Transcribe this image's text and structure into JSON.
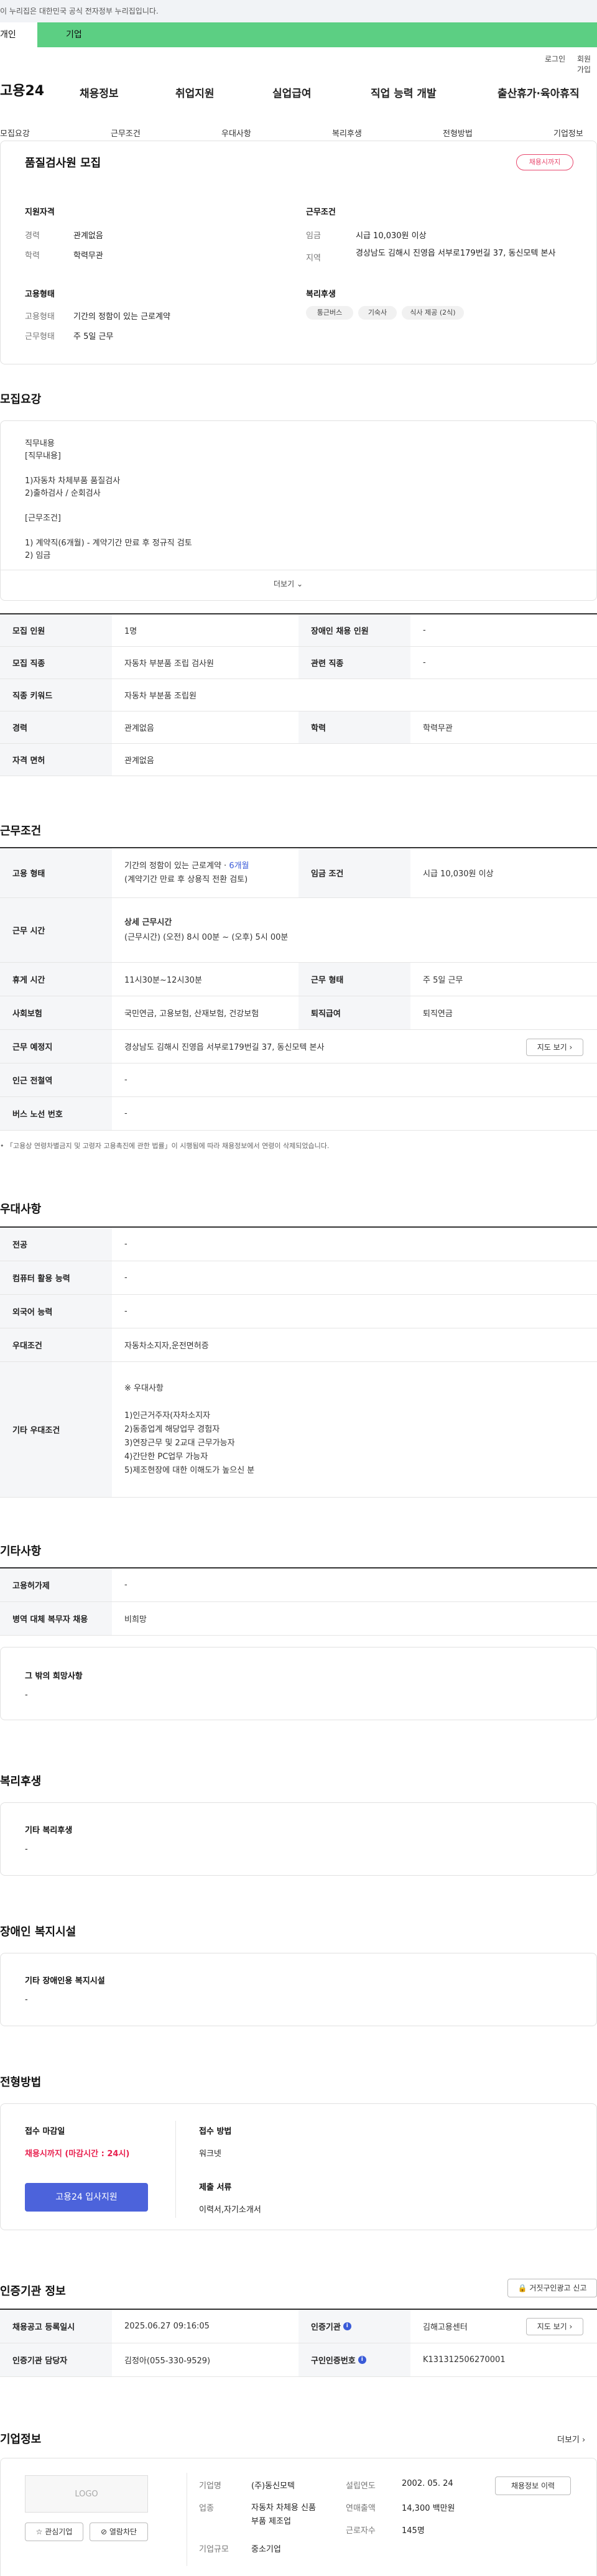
{
  "gov_banner": "이 누리집은 대한민국 공식 전자정부 누리집입니다.",
  "top_tabs": {
    "personal": "개인",
    "company": "기업"
  },
  "util": {
    "login": "로그인",
    "join": "회원가입"
  },
  "logo": "고용24",
  "gnb": [
    "채용정보",
    "취업지원",
    "실업급여",
    "직업 능력 개발",
    "출산휴가·육아휴직"
  ],
  "subnav": [
    "모집요강",
    "근무조건",
    "우대사항",
    "복리후생",
    "전형방법",
    "기업정보"
  ],
  "summary": {
    "title": "품질검사원 모집",
    "status_badge": "채용시까지",
    "qual_head": "지원자격",
    "career_label": "경력",
    "career_value": "관계없음",
    "edu_label": "학력",
    "edu_value": "학력무관",
    "emp_head": "고용형태",
    "emp_type_label": "고용형태",
    "emp_type_value": "기간의 정함이 있는 근로계약",
    "work_type_label": "근무형태",
    "work_type_value": "주 5일 근무",
    "cond_head": "근무조건",
    "wage_label": "임금",
    "wage_value": "시급 10,030원 이상",
    "region_label": "지역",
    "region_value": "경상남도 김해시 진영읍 서부로179번길 37, 동신모텍 본사",
    "welfare_head": "복리후생",
    "welfare_chips": [
      "통근버스",
      "기숙사",
      "식사 제공 (2식)"
    ]
  },
  "recruit": {
    "title": "모집요강",
    "detail_text": "직무내용\n[직무내용]\n\n1)자동차 차체부품 품질검사\n2)출하검사 / 순회검사\n\n[근무조건]\n\n1) 계약직(6개월) - 계약기간 만료 후 정규직 검토\n2) 임금",
    "more": "더보기",
    "rows": [
      {
        "th1": "모집 인원",
        "td1": "1명",
        "th2": "장애인 채용 인원",
        "td2": "-"
      },
      {
        "th1": "모집 직종",
        "td1": "자동차 부분품 조립 검사원",
        "th2": "관련 직종",
        "td2": "-"
      },
      {
        "th1": "직종 키워드",
        "td1": "자동차 부분품 조립원"
      },
      {
        "th1": "경력",
        "td1": "관계없음",
        "th2": "학력",
        "td2": "학력무관"
      },
      {
        "th1": "자격 면허",
        "td1": "관계없음"
      }
    ]
  },
  "conditions": {
    "title": "근무조건",
    "emp_type_label": "고용 형태",
    "emp_type_line1": "기간의 정함이 있는 근로계약 · ",
    "emp_type_months": "6개월",
    "emp_type_line2": "(계약기간 만료 후 상용직 전환 검토)",
    "wage_label": "임금 조건",
    "wage_value": "시급 10,030원 이상",
    "hours_label": "근무 시간",
    "hours_head": "상세 근무시간",
    "hours_value": "(근무시간) (오전) 8시 00분 ~ (오후) 5시 00분",
    "break_label": "휴게 시간",
    "break_value": "11시30분~12시30분",
    "form_label": "근무 형태",
    "form_value": "주 5일 근무",
    "insurance_label": "사회보험",
    "insurance_value": "국민연금, 고용보험, 산재보험, 건강보험",
    "retire_label": "퇴직급여",
    "retire_value": "퇴직연금",
    "place_label": "근무 예정지",
    "place_value": "경상남도 김해시 진영읍 서부로179번길 37, 동신모텍 본사",
    "map_btn": "지도 보기",
    "subway_label": "인근 전철역",
    "subway_value": "-",
    "bus_label": "버스 노선 번호",
    "bus_value": "-",
    "footnote": "「고용상 연령차별금지 및 고령자 고용촉진에 관한 법률」이 시행됨에 따라 채용정보에서 연령이 삭제되었습니다."
  },
  "preference": {
    "title": "우대사항",
    "major_label": "전공",
    "major_value": "-",
    "pc_label": "컴퓨터 활용 능력",
    "pc_value": "-",
    "lang_label": "외국어 능력",
    "lang_value": "-",
    "pref_label": "우대조건",
    "pref_value": "자동차소지자,운전면허증",
    "etc_label": "기타 우대조건",
    "etc_value": "※ 우대사항\n\n1)인근거주자(자차소지자\n2)동종업계 해당업무 경험자\n3)연장근무 및 2교대 근무가능자\n4)간단한 PC업무 가능자\n5)제조현장에 대한 이해도가 높으신 분"
  },
  "etc": {
    "title": "기타사항",
    "employment_label": "고용허가제",
    "employment_value": "-",
    "military_label": "병역 대체 복무자 채용",
    "military_value": "비희망",
    "other_head": "그 밖의 희망사항",
    "other_value": "-"
  },
  "welfare": {
    "title": "복리후생",
    "head": "기타 복리후생",
    "value": "-"
  },
  "disabled": {
    "title": "장애인 복지시설",
    "head": "기타 장애인용 복지시설",
    "value": "-"
  },
  "selection": {
    "title": "전형방법",
    "deadline_head": "접수 마감일",
    "deadline_value": "채용시까지 (마감시간 : 24시)",
    "apply_btn": "고용24 입사지원",
    "method_head": "접수 방법",
    "method_value": "워크넷",
    "docs_head": "제출 서류",
    "docs_value": "이력서,자기소개서"
  },
  "cert": {
    "title": "인증기관 정보",
    "report_btn": "거짓구인광고 신고",
    "reg_label": "채용공고 등록일시",
    "reg_value": "2025.06.27 09:16:05",
    "org_label": "인증기관",
    "org_value": "김해고용센터",
    "map_btn": "지도 보기",
    "manager_label": "인증기관 담당자",
    "manager_value": "김정아(055-330-9529)",
    "num_label": "구인인증번호",
    "num_value": "K131312506270001"
  },
  "company": {
    "title": "기업정보",
    "more": "더보기",
    "logo_text": "LOGO",
    "interest_btn": "관심기업",
    "block_btn": "열람차단",
    "name_label": "기업명",
    "name_value": "(주)동신모텍",
    "industry_label": "업종",
    "industry_value": "자동차 차체용 신품 부품 제조업",
    "size_label": "기업규모",
    "size_value": "중소기업",
    "founded_label": "설립연도",
    "founded_value": "2002. 05. 24",
    "sales_label": "연매출액",
    "sales_value": "14,300 백만원",
    "workers_label": "근로자수",
    "workers_value": "145명",
    "history_btn": "채용정보 이력"
  }
}
